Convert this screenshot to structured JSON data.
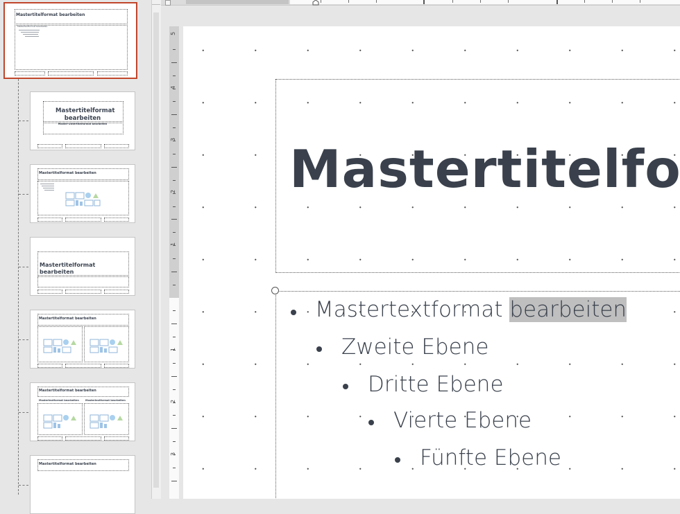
{
  "thumbnails": [
    {
      "title": "Mastertitelformat bearbeiten",
      "selected": true,
      "sub": "Mastertextformat bearbeiten"
    },
    {
      "title": "Mastertitelformat bearbeiten",
      "subtitle": "Master-Untertitelformat bearbeiten"
    },
    {
      "title": "Mastertitelformat bearbeiten"
    },
    {
      "title": "Mastertitelformat bearbeiten"
    },
    {
      "title": "Mastertitelformat bearbeiten"
    },
    {
      "title": "Mastertitelformat bearbeiten",
      "col1": "Mastertextformat bearbeiten",
      "col2": "Mastertextformat bearbeiten"
    },
    {
      "title": "Mastertitelformat bearbeiten"
    }
  ],
  "ruler": {
    "numbers": [
      "5",
      "4",
      "3",
      "2",
      "1",
      "0",
      "1",
      "2",
      "3"
    ]
  },
  "slide": {
    "title": "Mastertitelformat bearbeiten",
    "levels": [
      {
        "text": "Mastertextformat ",
        "highlight": "bearbeiten"
      },
      {
        "text": "Zweite Ebene"
      },
      {
        "text": "Dritte Ebene"
      },
      {
        "text": "Vierte Ebene"
      },
      {
        "text": "Fünfte Ebene"
      }
    ]
  },
  "colors": {
    "selection": "#c0452a",
    "text": "#3a414c",
    "highlight": "#bfbfbf"
  }
}
